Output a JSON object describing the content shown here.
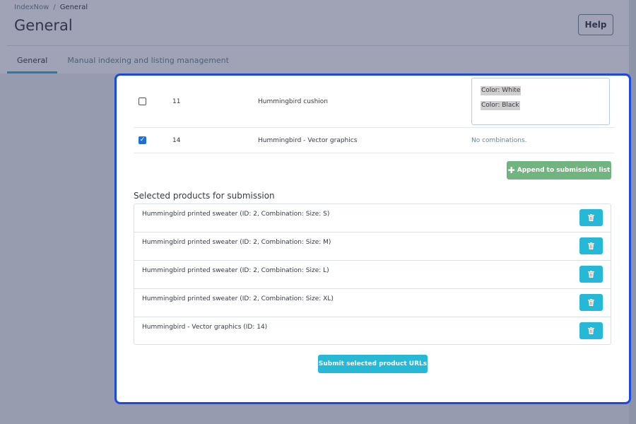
{
  "breadcrumb": {
    "parent": "IndexNow",
    "separator": "/",
    "current": "General"
  },
  "page_title": "General",
  "help_label": "Help",
  "tabs": [
    {
      "label": "General",
      "active": true
    },
    {
      "label": "Manual indexing and listing management",
      "active": false
    }
  ],
  "products": [
    {
      "checked": false,
      "id": "11",
      "name": "Hummingbird cushion",
      "combinations": [
        "Color: White",
        "Color: Black"
      ]
    },
    {
      "checked": true,
      "id": "14",
      "name": "Hummingbird - Vector graphics",
      "no_combinations_text": "No combinations."
    }
  ],
  "append_label": "Append to submission list",
  "selected_title": "Selected products for submission",
  "selected_items": [
    "Hummingbird printed sweater (ID: 2, Combination: Size: S)",
    "Hummingbird printed sweater (ID: 2, Combination: Size: M)",
    "Hummingbird printed sweater (ID: 2, Combination: Size: L)",
    "Hummingbird printed sweater (ID: 2, Combination: Size: XL)",
    "Hummingbird - Vector graphics (ID: 14)"
  ],
  "submit_label": "Submit selected product URLs",
  "colors": {
    "highlight_border": "#1b48e0",
    "primary": "#25b9d7",
    "success": "#70b580",
    "overlay": "rgba(44, 52, 94, 0.45)"
  },
  "icons": {
    "delete": "trash-icon",
    "append": "plus-icon",
    "checked": "checkmark-icon"
  }
}
